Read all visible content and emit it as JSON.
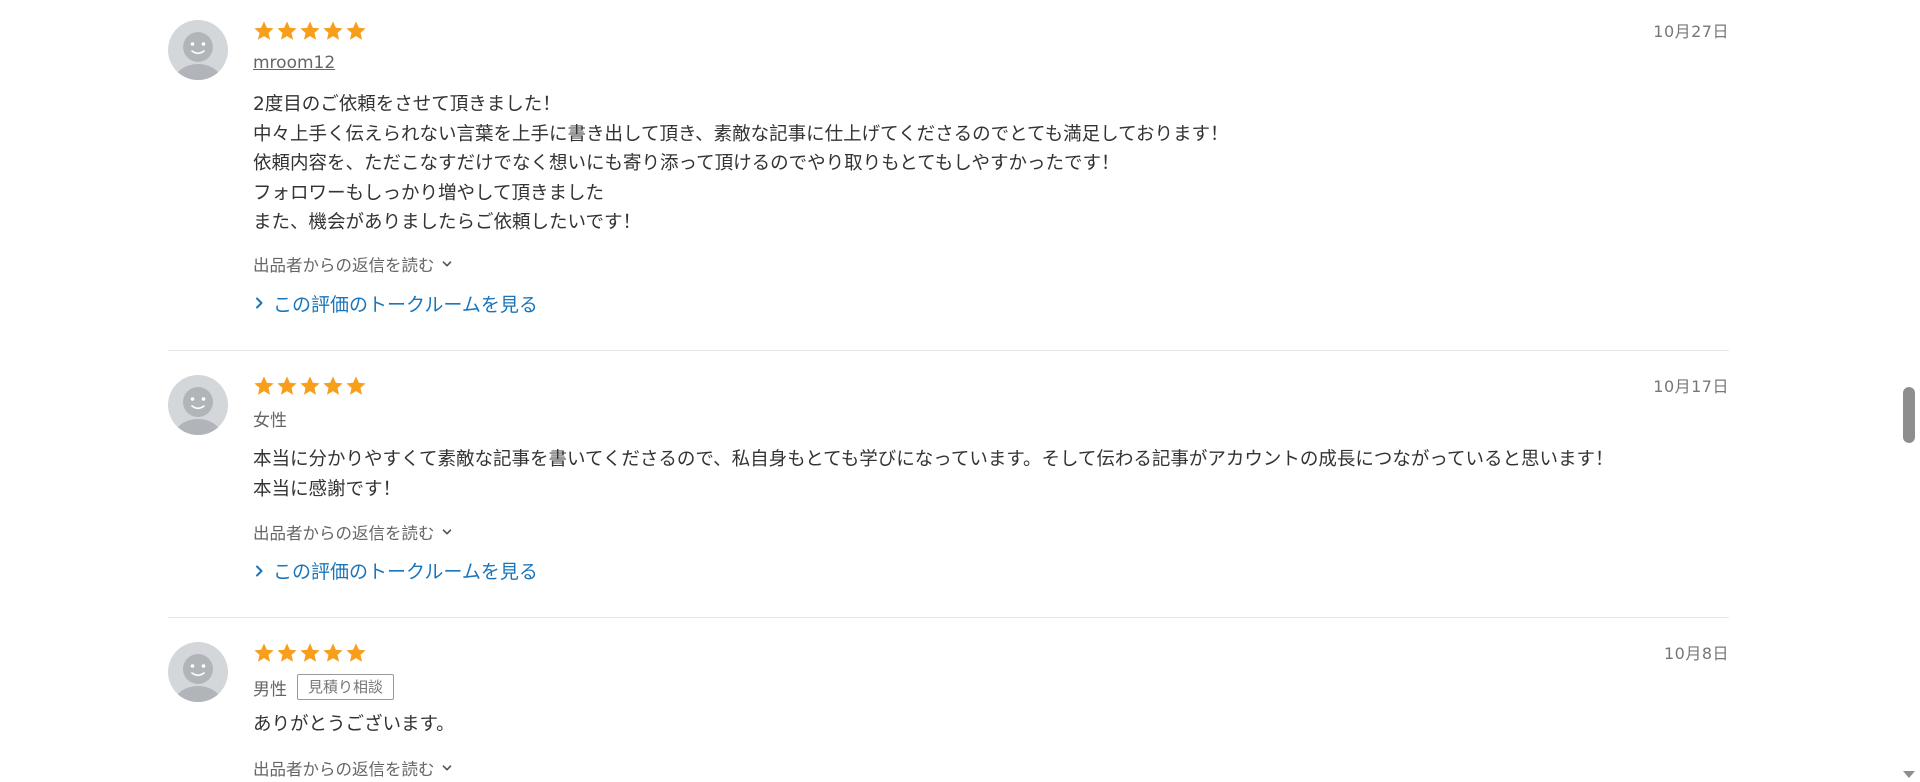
{
  "colors": {
    "star": "#f79e1b",
    "link": "#1a75bb",
    "avatar_bg": "#d4d7da",
    "avatar_fg": "#b1b5b9"
  },
  "reviews": [
    {
      "stars": 5,
      "date": "10月27日",
      "reviewer": "mroom12",
      "reviewer_is_link": true,
      "tag": "",
      "comment_lines": [
        "2度目のご依頼をさせて頂きました！",
        "中々上手く伝えられない言葉を上手に書き出して頂き、素敵な記事に仕上げてくださるのでとても満足しております！",
        "依頼内容を、ただこなすだけでなく想いにも寄り添って頂けるのでやり取りもとてもしやすかったです！",
        "フォロワーもしっかり増やして頂きました",
        "また、機会がありましたらご依頼したいです！"
      ],
      "reply_toggle": "出品者からの返信を読む",
      "talkroom_link": "この評価のトークルームを見る"
    },
    {
      "stars": 5,
      "date": "10月17日",
      "reviewer": "女性",
      "reviewer_is_link": false,
      "tag": "",
      "comment_lines": [
        "本当に分かりやすくて素敵な記事を書いてくださるので、私自身もとても学びになっています。そして伝わる記事がアカウントの成長につながっていると思います！",
        "本当に感謝です！"
      ],
      "reply_toggle": "出品者からの返信を読む",
      "talkroom_link": "この評価のトークルームを見る"
    },
    {
      "stars": 5,
      "date": "10月8日",
      "reviewer": "男性",
      "reviewer_is_link": false,
      "tag": "見積り相談",
      "comment_lines": [
        "ありがとうございます。"
      ],
      "reply_toggle": "出品者からの返信を読む",
      "talkroom_link": ""
    }
  ]
}
